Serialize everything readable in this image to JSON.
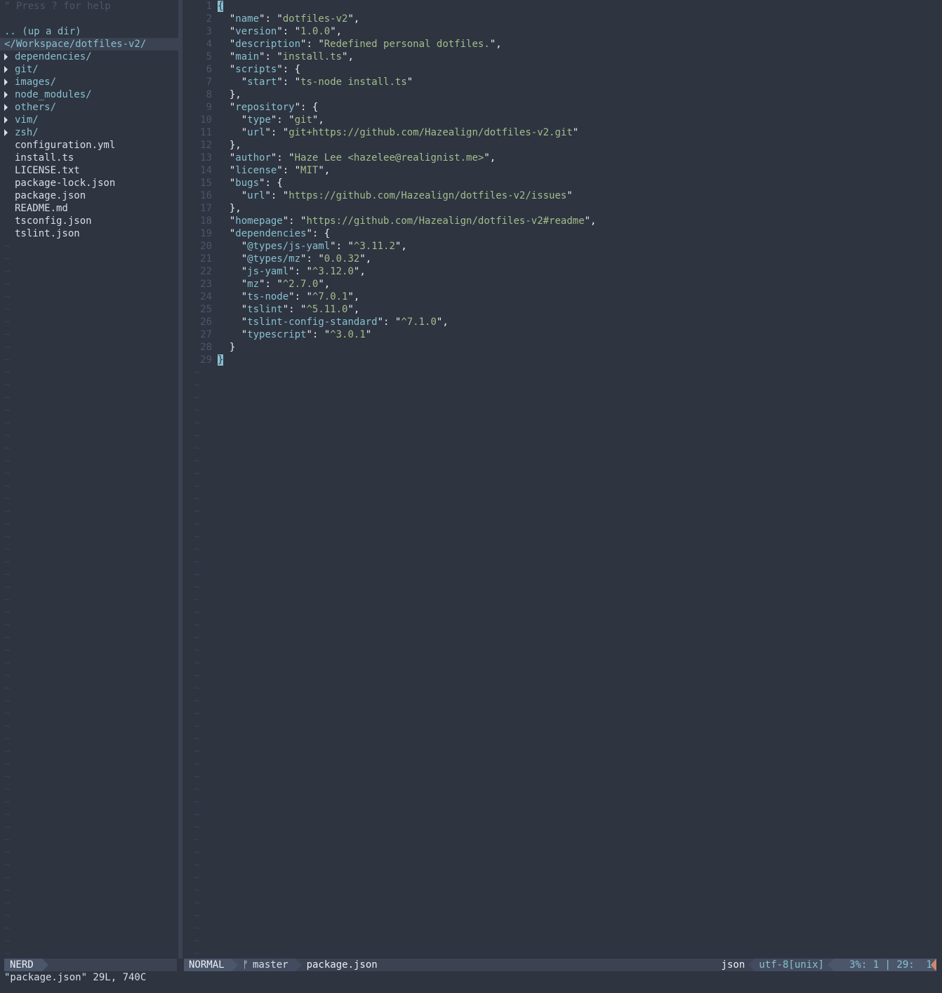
{
  "nerdtree": {
    "help": "\" Press ? for help",
    "up_dir": ".. (up a dir)",
    "cwd": "</Workspace/dotfiles-v2/",
    "entries": [
      {
        "name": "dependencies/",
        "type": "dir"
      },
      {
        "name": "git/",
        "type": "dir"
      },
      {
        "name": "images/",
        "type": "dir"
      },
      {
        "name": "node_modules/",
        "type": "dir"
      },
      {
        "name": "others/",
        "type": "dir"
      },
      {
        "name": "vim/",
        "type": "dir"
      },
      {
        "name": "zsh/",
        "type": "dir"
      },
      {
        "name": "configuration.yml",
        "type": "file"
      },
      {
        "name": "install.ts",
        "type": "file"
      },
      {
        "name": "LICENSE.txt",
        "type": "file"
      },
      {
        "name": "package-lock.json",
        "type": "file"
      },
      {
        "name": "package.json",
        "type": "file"
      },
      {
        "name": "README.md",
        "type": "file"
      },
      {
        "name": "tsconfig.json",
        "type": "file"
      },
      {
        "name": "tslint.json",
        "type": "file"
      }
    ],
    "status_label": "NERD"
  },
  "editor": {
    "lines": [
      "{",
      "  \"name\": \"dotfiles-v2\",",
      "  \"version\": \"1.0.0\",",
      "  \"description\": \"Redefined personal dotfiles.\",",
      "  \"main\": \"install.ts\",",
      "  \"scripts\": {",
      "    \"start\": \"ts-node install.ts\"",
      "  },",
      "  \"repository\": {",
      "    \"type\": \"git\",",
      "    \"url\": \"git+https://github.com/Hazealign/dotfiles-v2.git\"",
      "  },",
      "  \"author\": \"Haze Lee <hazelee@realignist.me>\",",
      "  \"license\": \"MIT\",",
      "  \"bugs\": {",
      "    \"url\": \"https://github.com/Hazealign/dotfiles-v2/issues\"",
      "  },",
      "  \"homepage\": \"https://github.com/Hazealign/dotfiles-v2#readme\",",
      "  \"dependencies\": {",
      "    \"@types/js-yaml\": \"^3.11.2\",",
      "    \"@types/mz\": \"0.0.32\",",
      "    \"js-yaml\": \"^3.12.0\",",
      "    \"mz\": \"^2.7.0\",",
      "    \"ts-node\": \"^7.0.1\",",
      "    \"tslint\": \"^5.11.0\",",
      "    \"tslint-config-standard\": \"^7.1.0\",",
      "    \"typescript\": \"^3.0.1\"",
      "  }",
      "}"
    ]
  },
  "statusline": {
    "mode": "NORMAL",
    "branch": "master",
    "filename": "package.json",
    "filetype": "json",
    "encoding": "utf-8[unix]",
    "position": "3%: 1 | 29:  1",
    "branch_icon": "branch-icon"
  },
  "cmdline": "\"package.json\" 29L, 740C",
  "colors": {
    "background": "#2e3440",
    "accent": "#88c0d0",
    "string": "#a3be8c",
    "warning": "#d08770"
  }
}
